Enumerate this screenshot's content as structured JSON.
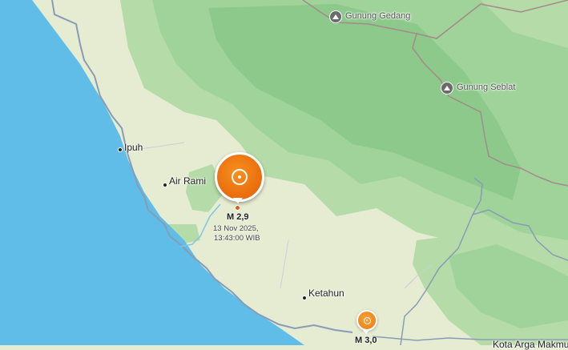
{
  "places": {
    "ipuh": "Ipuh",
    "air_rami": "Air Rami",
    "ketahun": "Ketahun",
    "kota_arga_makmur": "Kota Arga Makmu"
  },
  "mountains": {
    "gunung_gedang": "Gunung Gedang",
    "gunung_seblat": "Gunung Seblat"
  },
  "earthquakes": [
    {
      "magnitude": "M 2,9",
      "date": "13 Nov 2025,",
      "time": "13:43:00 WIB"
    },
    {
      "magnitude": "M 3,0"
    }
  ],
  "colors": {
    "sea": "#5fbde8",
    "land": "#e6ecd2",
    "forest": "#9fd39a",
    "road": "#8a9bb5",
    "boundary": "#a58a8a",
    "quake": "#e8650a"
  },
  "icons": {
    "peak": "mountain-peak-icon",
    "quake": "earthquake-marker-icon"
  }
}
